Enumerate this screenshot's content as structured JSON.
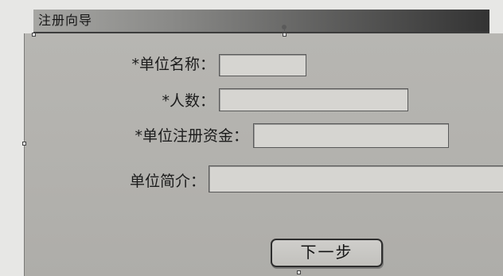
{
  "window": {
    "title": "注册向导"
  },
  "form": {
    "fields": [
      {
        "label": "*单位名称：",
        "value": ""
      },
      {
        "label": "*人数：",
        "value": ""
      },
      {
        "label": "*单位注册资金：",
        "value": ""
      },
      {
        "label": "单位简介：",
        "value": ""
      }
    ],
    "next_button": "下一步"
  },
  "colors": {
    "panel_background": "#b4b3af",
    "titlebar_dark": "#333333",
    "input_background": "#d6d5d1"
  }
}
